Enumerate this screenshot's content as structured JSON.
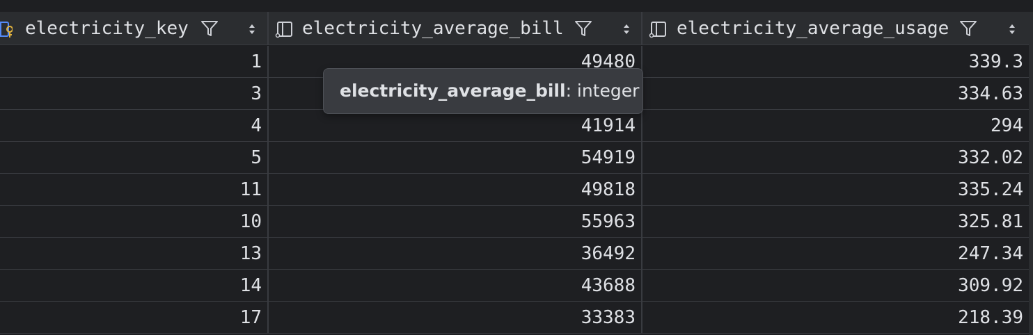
{
  "colors": {
    "background": "#1e1f22",
    "header_background": "#2b2d30",
    "grid_line": "#393b40",
    "text": "#dfe1e5",
    "icon": "#ced0d6",
    "key_icon_accent": "#e5b53e",
    "key_icon_blue": "#548af7"
  },
  "columns": [
    {
      "name": "electricity_key",
      "icon": "primary-key-column-icon"
    },
    {
      "name": "electricity_average_bill",
      "icon": "column-icon"
    },
    {
      "name": "electricity_average_usage",
      "icon": "column-icon"
    }
  ],
  "rows": [
    [
      "1",
      "49480",
      "339.3"
    ],
    [
      "3",
      "",
      "334.63"
    ],
    [
      "4",
      "41914",
      "294"
    ],
    [
      "5",
      "54919",
      "332.02"
    ],
    [
      "11",
      "49818",
      "335.24"
    ],
    [
      "10",
      "55963",
      "325.81"
    ],
    [
      "13",
      "36492",
      "247.34"
    ],
    [
      "14",
      "43688",
      "309.92"
    ],
    [
      "17",
      "33383",
      "218.39"
    ]
  ],
  "tooltip": {
    "column_name": "electricity_average_bill",
    "type_text": ": integer"
  }
}
